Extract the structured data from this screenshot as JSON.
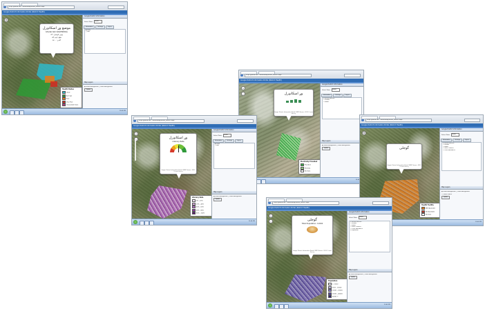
{
  "browser": {
    "address_text": "http://gisweb.eds.../sharedmap/health_district.aspx",
    "window_title": "Google District Health"
  },
  "app": {
    "banner_title": "Google District Information Portal (District Health)"
  },
  "map_popups": {
    "shot1": {
      "title": "موضع وړ اسکانډرل",
      "subtitle": "Ghulab Keh DAGHNDRAL",
      "lines": [
        "یونین کونسل: ۱۲۲",
        "ضلع: ایبټ آباد",
        "آبادی: ۵۶۰۰"
      ]
    },
    "shot2": {
      "title": "وړ اسکانډرل",
      "subtitle": "Literacy Rate",
      "footer": "Google District Information Portal (GDIP) Source: 2012 Census Survey"
    },
    "shot3": {
      "title": "وړ اسکانډرل",
      "footer": "Google District Information Portal (GDIP) Source: 2012 Census Survey"
    },
    "shot4": {
      "title": "گوجلی",
      "footer": "Google District Information Portal (GDIP) Source: 2012 Census Survey"
    },
    "shot5": {
      "title": "گوجلی",
      "subtitle": "Total Population: 11002",
      "footer": "Google District Information Portal (GDIP) Source: 2012 Census Survey"
    }
  },
  "legends": {
    "shot1": {
      "title": "Health Status",
      "items": [
        {
          "label": "Good",
          "color": "#2fb8c9"
        },
        {
          "label": "Average",
          "color": "#2e9a35"
        },
        {
          "label": "Poor",
          "color": "#e67c1b"
        },
        {
          "label": "Very Poor",
          "color": "#d02b20"
        },
        {
          "label": "Unavailable Data",
          "color": "#b23d86"
        }
      ]
    },
    "shot2": {
      "title": "Literacy Rate",
      "items": [
        {
          "label": "0% - 20%",
          "color": "#f4e6f6"
        },
        {
          "label": "20% - 40%",
          "color": "#d7a9de"
        },
        {
          "label": "40% - 60%",
          "color": "#b46ac2"
        },
        {
          "label": "60% - 80%",
          "color": "#8a3a9d"
        },
        {
          "label": "80% - 100%",
          "color": "#5b1b70"
        }
      ]
    },
    "shot3": {
      "title": "Electricity Provided",
      "items": [
        {
          "label": "Provided",
          "color": "#3ab04a"
        },
        {
          "label": "Partially",
          "color": "#9bd08a"
        },
        {
          "label": "No Data",
          "color": "#ffffff"
        }
      ]
    },
    "shot4": {
      "title": "Health Facility",
      "items": [
        {
          "label": "BHU Available",
          "color": "#e6821f"
        },
        {
          "label": "Not Available",
          "color": "#c0392b"
        },
        {
          "label": "No Data",
          "color": "#ffffff"
        }
      ]
    },
    "shot5": {
      "title": "Population",
      "items": [
        {
          "label": "0 - 5000",
          "color": "#e8e4f3"
        },
        {
          "label": "5001 - 10000",
          "color": "#b8b0dc"
        },
        {
          "label": "10001 - 20000",
          "color": "#8577c1"
        },
        {
          "label": "20001 - 40000",
          "color": "#5a4aa3"
        },
        {
          "label": "40001 +",
          "color": "#33266f"
        }
      ]
    }
  },
  "panel": {
    "header": "Google District Information",
    "tabs": [
      "Information",
      "Settings",
      "Layers"
    ],
    "select_label": "Select Data:",
    "select_value": "Health",
    "radio_options": [
      "Show",
      "Hide"
    ],
    "options": [
      "Health Facilities",
      "Schools",
      "Roads",
      "Union Councils",
      "Tehsil Boundaries",
      "Population"
    ],
    "background_header": "Map Layers",
    "background_options": [
      "Show Background",
      "Hide Background"
    ],
    "labels_option": "Show Labels",
    "apply_button": "Update"
  },
  "taskbar": {
    "clock": "12:45 PM"
  },
  "icon_names": [
    "start-orb-icon",
    "taskbar-app-icon",
    "zoom-in-icon",
    "zoom-out-icon",
    "pan-icon"
  ]
}
